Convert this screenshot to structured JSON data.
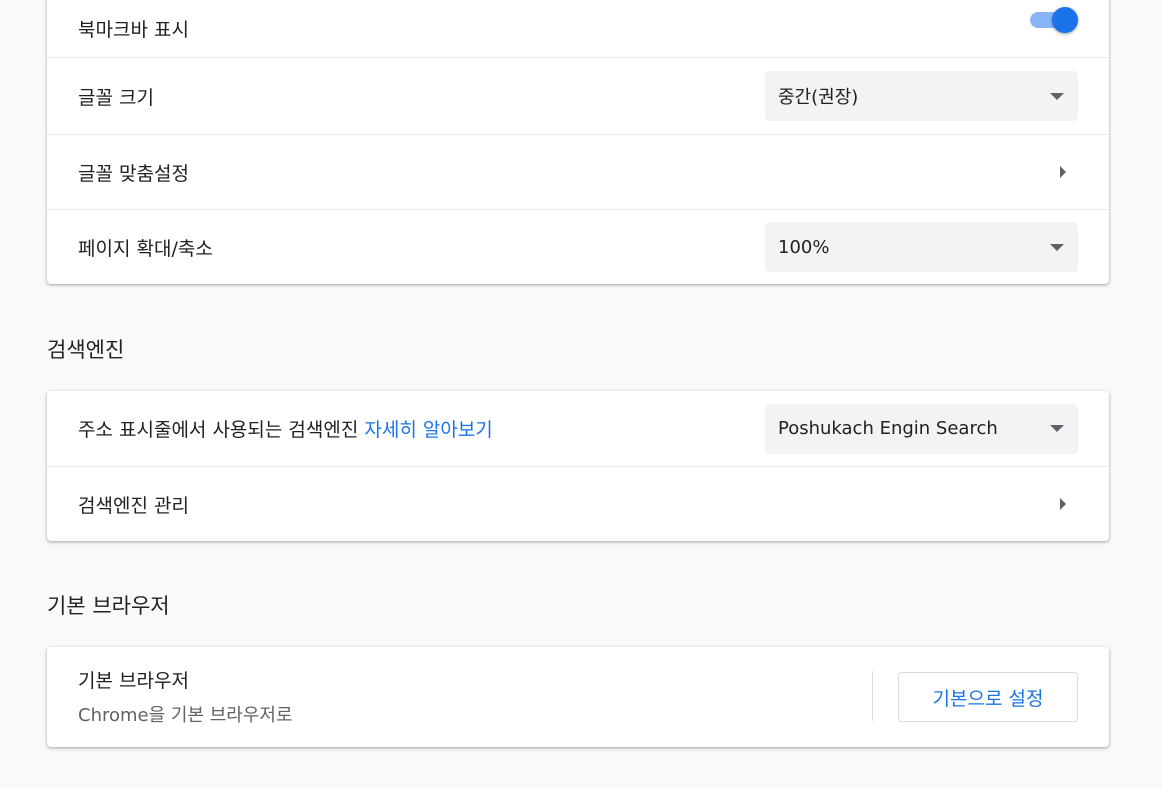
{
  "appearance": {
    "bookmark_bar_label": "북마크바 표시",
    "bookmark_bar_enabled": true,
    "font_size_label": "글꼴 크기",
    "font_size_value": "중간(권장)",
    "customize_fonts_label": "글꼴 맞춤설정",
    "page_zoom_label": "페이지 확대/축소",
    "page_zoom_value": "100%"
  },
  "search_engine": {
    "section_title": "검색엔진",
    "address_bar_label": "주소 표시줄에서 사용되는 검색엔진",
    "learn_more_link": "자세히 알아보기",
    "engine_value": "Poshukach Engin Search",
    "manage_label": "검색엔진 관리"
  },
  "default_browser": {
    "section_title": "기본 브라우저",
    "row_title": "기본 브라우저",
    "row_subtitle": "Chrome을 기본 브라우저로",
    "make_default_button": "기본으로 설정"
  },
  "colors": {
    "accent": "#1a73e8",
    "toggle_track": "#8ab4f8",
    "page_background": "#f8f9fa",
    "select_background": "#f1f3f4"
  }
}
